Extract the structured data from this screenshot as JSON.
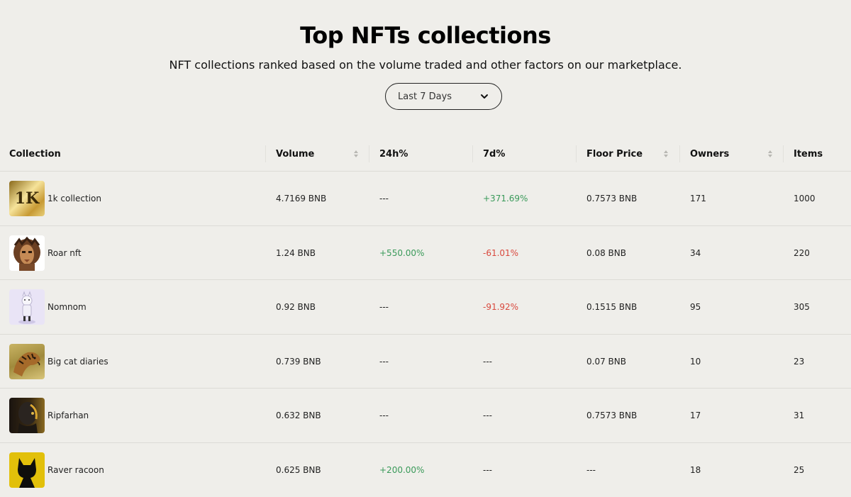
{
  "header": {
    "title": "Top NFTs collections",
    "subtitle": "NFT collections ranked based on the volume traded and other factors on our marketplace."
  },
  "filter": {
    "selected": "Last 7 Days"
  },
  "table": {
    "columns": [
      "Collection",
      "Volume",
      "24h%",
      "7d%",
      "Floor Price",
      "Owners",
      "Items"
    ],
    "rows": [
      {
        "name": "1k collection",
        "thumb_text": "1K",
        "volume": "4.7169 BNB",
        "change_24h": "---",
        "change_7d": "+371.69%",
        "floor": "0.7573 BNB",
        "owners": "171",
        "items": "1000"
      },
      {
        "name": "Roar nft",
        "volume": "1.24 BNB",
        "change_24h": "+550.00%",
        "change_7d": "-61.01%",
        "floor": "0.08 BNB",
        "owners": "34",
        "items": "220"
      },
      {
        "name": "Nomnom",
        "volume": "0.92 BNB",
        "change_24h": "---",
        "change_7d": "-91.92%",
        "floor": "0.1515 BNB",
        "owners": "95",
        "items": "305"
      },
      {
        "name": "Big cat diaries",
        "volume": "0.739 BNB",
        "change_24h": "---",
        "change_7d": "---",
        "floor": "0.07 BNB",
        "owners": "10",
        "items": "23"
      },
      {
        "name": "Ripfarhan",
        "volume": "0.632 BNB",
        "change_24h": "---",
        "change_7d": "---",
        "floor": "0.7573 BNB",
        "owners": "17",
        "items": "31"
      },
      {
        "name": "Raver racoon",
        "volume": "0.625 BNB",
        "change_24h": "+200.00%",
        "change_7d": "---",
        "floor": "---",
        "owners": "18",
        "items": "25"
      }
    ]
  },
  "colors": {
    "background": "#efeeea",
    "positive": "#3a9a5a",
    "negative": "#d9493e"
  },
  "icons": {
    "dropdown": "chevron-down-icon",
    "sort": "sort-icon"
  }
}
